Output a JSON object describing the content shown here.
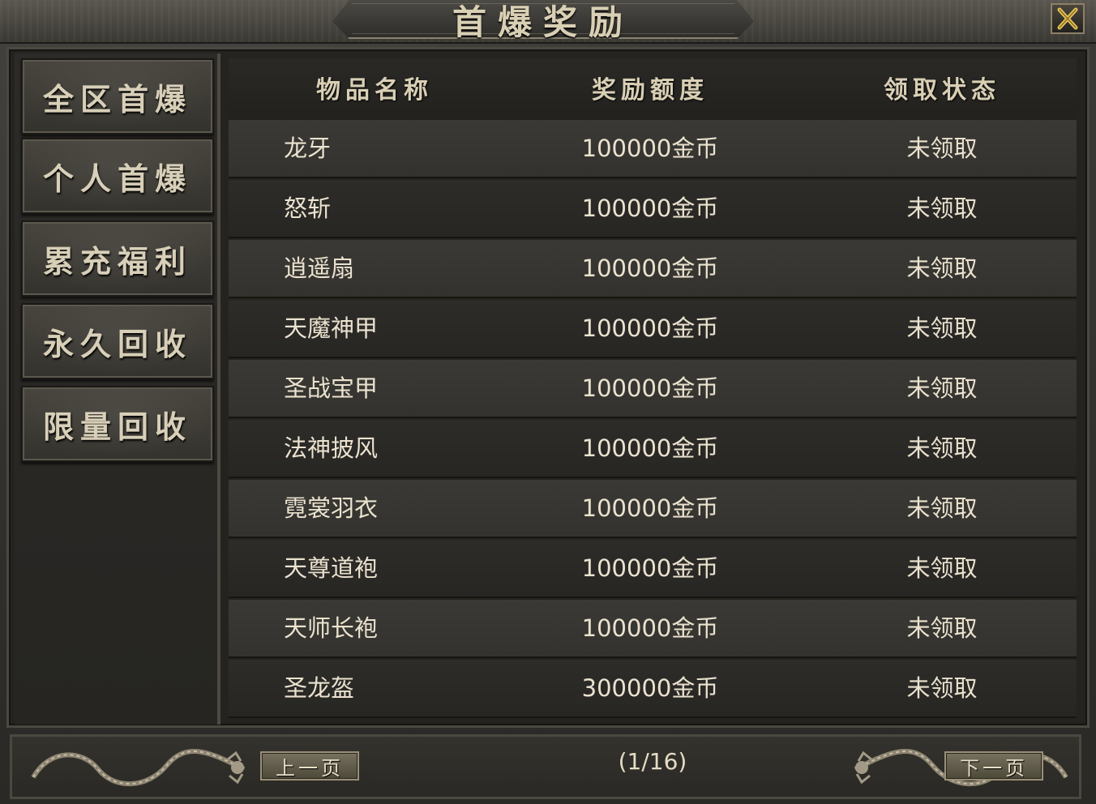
{
  "window": {
    "title": "首爆奖励",
    "close_icon": "close-x-icon"
  },
  "sidebar": {
    "items": [
      {
        "label": "全区首爆"
      },
      {
        "label": "个人首爆"
      },
      {
        "label": "累充福利"
      },
      {
        "label": "永久回收"
      },
      {
        "label": "限量回收"
      }
    ]
  },
  "table": {
    "headers": {
      "name": "物品名称",
      "reward": "奖励额度",
      "status": "领取状态"
    },
    "rows": [
      {
        "name": "龙牙",
        "reward": "100000金币",
        "status": "未领取"
      },
      {
        "name": "怒斩",
        "reward": "100000金币",
        "status": "未领取"
      },
      {
        "name": "逍遥扇",
        "reward": "100000金币",
        "status": "未领取"
      },
      {
        "name": "天魔神甲",
        "reward": "100000金币",
        "status": "未领取"
      },
      {
        "name": "圣战宝甲",
        "reward": "100000金币",
        "status": "未领取"
      },
      {
        "name": "法神披风",
        "reward": "100000金币",
        "status": "未领取"
      },
      {
        "name": "霓裳羽衣",
        "reward": "100000金币",
        "status": "未领取"
      },
      {
        "name": "天尊道袍",
        "reward": "100000金币",
        "status": "未领取"
      },
      {
        "name": "天师长袍",
        "reward": "100000金币",
        "status": "未领取"
      },
      {
        "name": "圣龙盔",
        "reward": "300000金币",
        "status": "未领取"
      }
    ]
  },
  "footer": {
    "prev_label": "上一页",
    "next_label": "下一页",
    "page_indicator": "(1/16)",
    "ornament_icon": "dragon-ornament-icon"
  },
  "colors": {
    "text": "#e6dcc6",
    "frame": "#4b4840",
    "row_light": "#3a3935",
    "row_dark": "#2d2c29"
  }
}
